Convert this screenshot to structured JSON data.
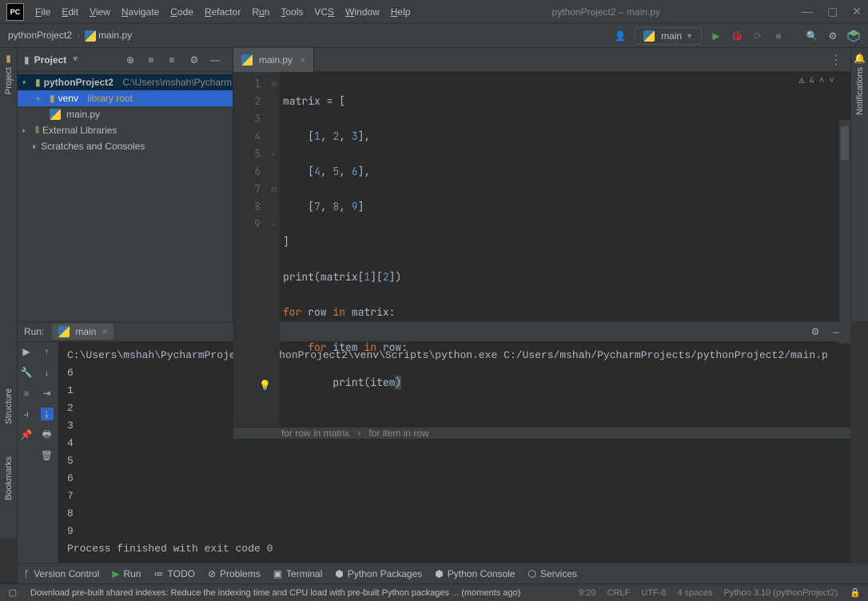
{
  "window": {
    "title": "pythonProject2 – main.py"
  },
  "menu": [
    {
      "label": "File",
      "u": "F"
    },
    {
      "label": "Edit",
      "u": "E"
    },
    {
      "label": "View",
      "u": "V"
    },
    {
      "label": "Navigate",
      "u": "N"
    },
    {
      "label": "Code",
      "u": "C"
    },
    {
      "label": "Refactor",
      "u": "R"
    },
    {
      "label": "Run",
      "u": "R"
    },
    {
      "label": "Tools",
      "u": "T"
    },
    {
      "label": "VCS",
      "u": "S"
    },
    {
      "label": "Window",
      "u": "W"
    },
    {
      "label": "Help",
      "u": "H"
    }
  ],
  "breadcrumb": {
    "project": "pythonProject2",
    "file": "main.py"
  },
  "runconfig": {
    "name": "main"
  },
  "project_panel": {
    "title": "Project",
    "tree": {
      "root": "pythonProject2",
      "root_path": "C:\\Users\\mshah\\Pycharm",
      "venv": "venv",
      "venv_note": "library root",
      "file": "main.py",
      "ext": "External Libraries",
      "scratch": "Scratches and Consoles"
    }
  },
  "editor": {
    "tab": "main.py",
    "badges": {
      "warn_count": "4"
    },
    "lines": [
      "matrix = [",
      "    [1, 2, 3],",
      "    [4, 5, 6],",
      "    [7, 8, 9]",
      "]",
      "print(matrix[1][2])",
      "for row in matrix:",
      "    for item in row:",
      "        print(item)"
    ],
    "crumb1": "for row in matrix",
    "crumb2": "for item in row"
  },
  "run": {
    "label": "Run:",
    "tab": "main",
    "cmd": "C:\\Users\\mshah\\PycharmProjects\\pythonProject2\\venv\\Scripts\\python.exe C:/Users/mshah/PycharmProjects/pythonProject2/main.p",
    "out": [
      "6",
      "1",
      "2",
      "3",
      "4",
      "5",
      "6",
      "7",
      "8",
      "9",
      "",
      "Process finished with exit code 0"
    ]
  },
  "bottom": [
    "Version Control",
    "Run",
    "TODO",
    "Problems",
    "Terminal",
    "Python Packages",
    "Python Console",
    "Services"
  ],
  "status": {
    "msg": "Download pre-built shared indexes: Reduce the indexing time and CPU load with pre-built Python packages ... (moments ago)",
    "pos": "9:20",
    "eol": "CRLF",
    "enc": "UTF-8",
    "indent": "4 spaces",
    "interp": "Python 3.10 (pythonProject2)"
  },
  "sidebars": {
    "project": "Project",
    "notifications": "Notifications",
    "structure": "Structure",
    "bookmarks": "Bookmarks"
  }
}
